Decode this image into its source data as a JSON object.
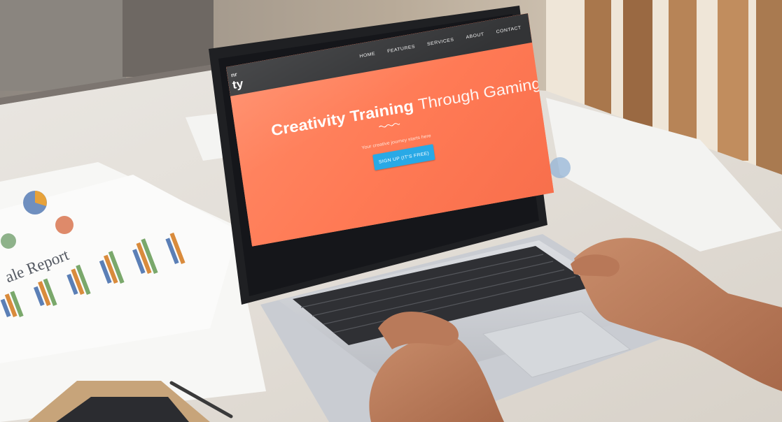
{
  "website": {
    "logo": {
      "line1": "nr",
      "line2": "ty"
    },
    "nav": [
      "HOME",
      "FEATURES",
      "SERVICES",
      "ABOUT",
      "CONTACT"
    ],
    "hero": {
      "headline_bold": "Creativity Training",
      "headline_light": "Through Gaming",
      "tagline": "Your creative journey starts here",
      "cta_label": "SIGN UP (IT'S FREE)"
    }
  },
  "paper": {
    "report_title": "ale Report"
  },
  "colors": {
    "hero_orange": "#ff7f5c",
    "nav_bar": "#333436",
    "cta_blue": "#29a9e6"
  }
}
